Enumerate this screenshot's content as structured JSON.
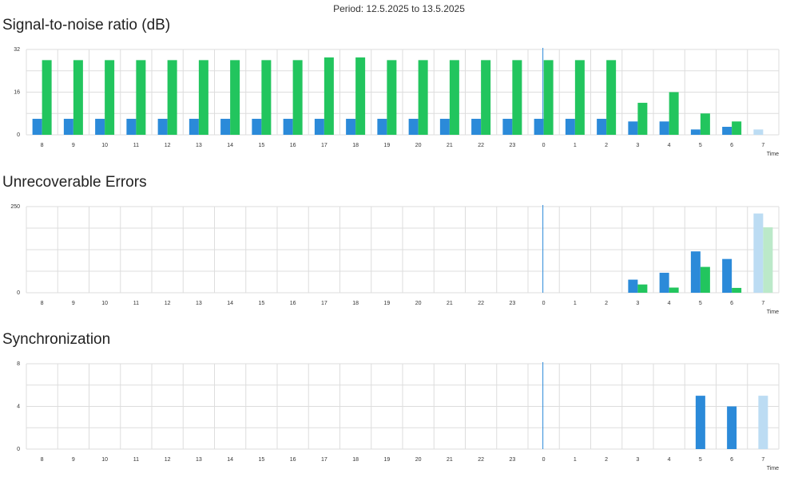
{
  "period_text": "Period: 12.5.2025 to 13.5.2025",
  "colors": {
    "series_blue": "#2b8ad9",
    "series_green": "#22c55e",
    "series_blue_light": "#bcdcf3",
    "series_green_light": "#bbe9c9",
    "grid": "#dddddd",
    "now_line": "#2b8ad9"
  },
  "chart_data": [
    {
      "type": "bar",
      "title": "Signal-to-noise ratio (dB)",
      "xlabel": "Time",
      "categories": [
        "8",
        "9",
        "10",
        "11",
        "12",
        "13",
        "14",
        "15",
        "16",
        "17",
        "18",
        "19",
        "20",
        "21",
        "22",
        "23",
        "0",
        "1",
        "2",
        "3",
        "4",
        "5",
        "6",
        "7"
      ],
      "ylim": [
        0,
        32
      ],
      "yticks": [
        "0",
        "16",
        "32"
      ],
      "grid": true,
      "now_marker_at": "0",
      "highlight_last_category": true,
      "series": [
        {
          "color_key": "series_blue",
          "values": [
            6,
            6,
            6,
            6,
            6,
            6,
            6,
            6,
            6,
            6,
            6,
            6,
            6,
            6,
            6,
            6,
            6,
            6,
            6,
            5,
            5,
            2,
            3,
            2
          ]
        },
        {
          "color_key": "series_green",
          "values": [
            28,
            28,
            28,
            28,
            28,
            28,
            28,
            28,
            28,
            29,
            29,
            28,
            28,
            28,
            28,
            28,
            28,
            28,
            28,
            12,
            16,
            8,
            5,
            0
          ]
        }
      ]
    },
    {
      "type": "bar",
      "title": "Unrecoverable Errors",
      "xlabel": "Time",
      "categories": [
        "8",
        "9",
        "10",
        "11",
        "12",
        "13",
        "14",
        "15",
        "16",
        "17",
        "18",
        "19",
        "20",
        "21",
        "22",
        "23",
        "0",
        "1",
        "2",
        "3",
        "4",
        "5",
        "6",
        "7"
      ],
      "ylim": [
        0,
        250
      ],
      "yticks": [
        "0",
        "250"
      ],
      "grid": true,
      "now_marker_at": "0",
      "highlight_last_category": true,
      "series": [
        {
          "color_key": "series_blue",
          "values": [
            0,
            0,
            0,
            0,
            0,
            0,
            0,
            0,
            0,
            0,
            0,
            0,
            0,
            0,
            0,
            0,
            0,
            0,
            0,
            38,
            58,
            120,
            98,
            230
          ]
        },
        {
          "color_key": "series_green",
          "values": [
            0,
            0,
            0,
            0,
            0,
            0,
            0,
            0,
            0,
            0,
            0,
            0,
            0,
            0,
            0,
            0,
            0,
            0,
            0,
            24,
            15,
            75,
            14,
            190
          ]
        }
      ]
    },
    {
      "type": "bar",
      "title": "Synchronization",
      "xlabel": "Time",
      "categories": [
        "8",
        "9",
        "10",
        "11",
        "12",
        "13",
        "14",
        "15",
        "16",
        "17",
        "18",
        "19",
        "20",
        "21",
        "22",
        "23",
        "0",
        "1",
        "2",
        "3",
        "4",
        "5",
        "6",
        "7"
      ],
      "ylim": [
        0,
        8
      ],
      "yticks": [
        "0",
        "4",
        "8"
      ],
      "grid": true,
      "now_marker_at": "0",
      "highlight_last_category": true,
      "series": [
        {
          "color_key": "series_blue",
          "values": [
            0,
            0,
            0,
            0,
            0,
            0,
            0,
            0,
            0,
            0,
            0,
            0,
            0,
            0,
            0,
            0,
            0,
            0,
            0,
            0,
            0,
            5,
            4,
            5
          ]
        }
      ]
    }
  ]
}
